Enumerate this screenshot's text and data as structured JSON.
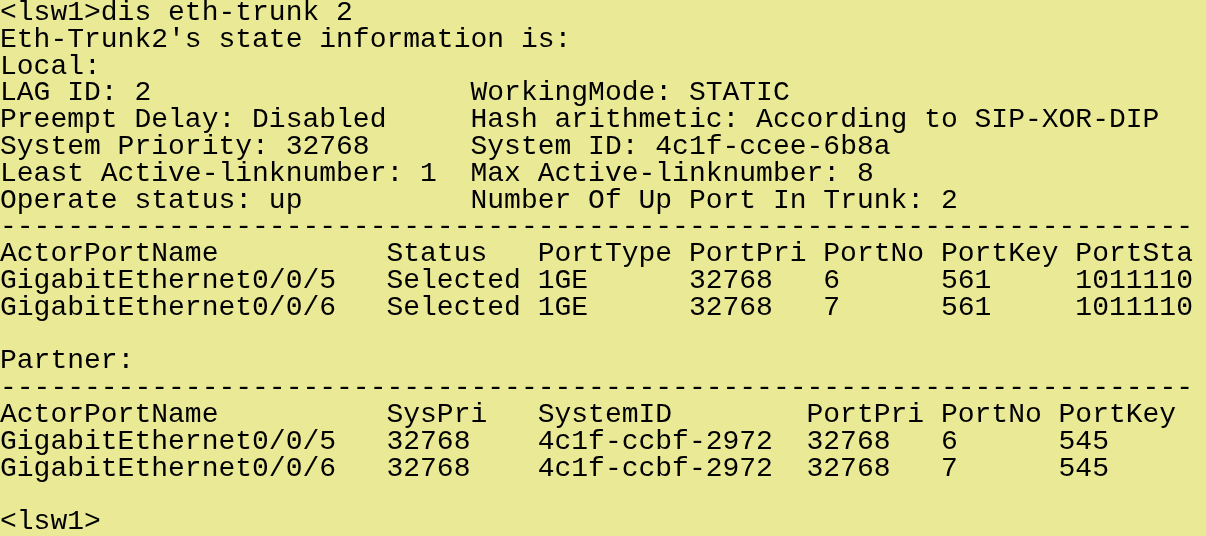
{
  "prompt_command": "<lsw1>dis eth-trunk 2",
  "heading": "Eth-Trunk2's state information is:",
  "local": {
    "label": "Local:",
    "pairs": [
      {
        "left": "LAG ID: 2",
        "right": "WorkingMode: STATIC"
      },
      {
        "left": "Preempt Delay: Disabled",
        "right": "Hash arithmetic: According to SIP-XOR-DIP"
      },
      {
        "left": "System Priority: 32768",
        "right": "System ID: 4c1f-ccee-6b8a"
      },
      {
        "left": "Least Active-linknumber: 1",
        "right": "Max Active-linknumber: 8"
      },
      {
        "left": "Operate status: up",
        "right": "Number Of Up Port In Trunk: 2"
      }
    ],
    "separator": "-----------------------------------------------------------------------",
    "table": {
      "columns": [
        "ActorPortName",
        "Status",
        "PortType",
        "PortPri",
        "PortNo",
        "PortKey",
        "PortSta"
      ],
      "rows": [
        [
          "GigabitEthernet0/0/5",
          "Selected",
          "1GE",
          "32768",
          "6",
          "561",
          "1011110"
        ],
        [
          "GigabitEthernet0/0/6",
          "Selected",
          "1GE",
          "32768",
          "7",
          "561",
          "1011110"
        ]
      ]
    }
  },
  "partner": {
    "label": "Partner:",
    "separator": "-----------------------------------------------------------------------",
    "table": {
      "columns": [
        "ActorPortName",
        "SysPri",
        "SystemID",
        "PortPri",
        "PortNo",
        "PortKey"
      ],
      "rows": [
        [
          "GigabitEthernet0/0/5",
          "32768",
          "4c1f-ccbf-2972",
          "32768",
          "6",
          "545"
        ],
        [
          "GigabitEthernet0/0/6",
          "32768",
          "4c1f-ccbf-2972",
          "32768",
          "7",
          "545"
        ]
      ]
    }
  },
  "next_prompt": "<lsw1>"
}
